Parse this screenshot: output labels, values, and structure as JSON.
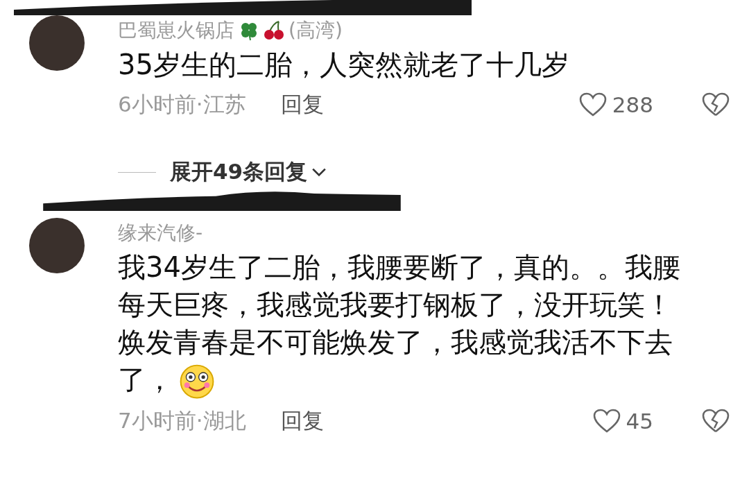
{
  "comments": [
    {
      "username": "巴蜀崽火锅店",
      "name_suffix": "(高湾)",
      "text": "35岁生的二胎，人突然就老了十几岁",
      "emoji": false,
      "time": "6小时前·江苏",
      "reply": "回复",
      "likes": "288"
    },
    {
      "username": "缘来汽修-",
      "text": "我34岁生了二胎，我腰要断了，真的。。我腰每天巨疼，我感觉我要打钢板了，没开玩笑！焕发青春是不可能焕发了，我感觉我活不下去了，",
      "emoji": true,
      "time": "7小时前·湖北",
      "reply": "回复",
      "likes": "45"
    }
  ],
  "expand": {
    "label": "展开49条回复"
  }
}
